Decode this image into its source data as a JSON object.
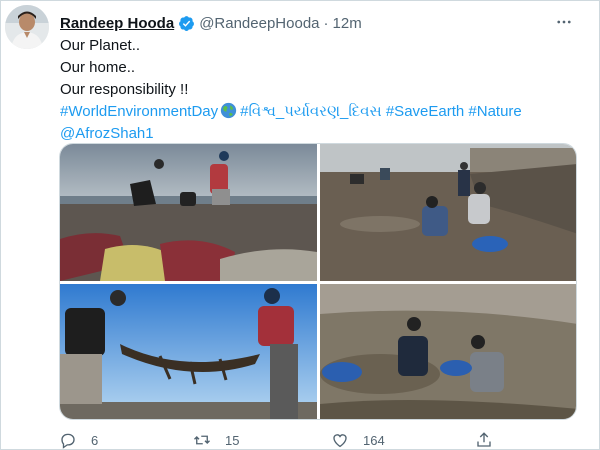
{
  "tweet": {
    "author_name": "Randeep Hooda",
    "handle": "@RandeepHooda",
    "separator": "·",
    "time": "12m",
    "lines": [
      "Our Planet..",
      "Our home..",
      "Our responsibility !!"
    ],
    "hashtags_line": {
      "tag1": "#WorldEnvironmentDay",
      "tag2": "#વિશ્વ_પર્યાવરણ_દિવસ",
      "tag3": "#SaveEarth",
      "tag4": "#Nature"
    },
    "mention": "@AfrozShah1"
  },
  "actions": {
    "reply_count": "6",
    "retweet_count": "15",
    "like_count": "164"
  },
  "colors": {
    "link": "#1d9bf0",
    "secondary_text": "#536471",
    "verified": "#1d9bf0"
  },
  "icons": [
    "verified-badge-icon",
    "more-options-icon",
    "earth-globe-icon",
    "reply-icon",
    "retweet-icon",
    "like-icon",
    "share-icon"
  ]
}
